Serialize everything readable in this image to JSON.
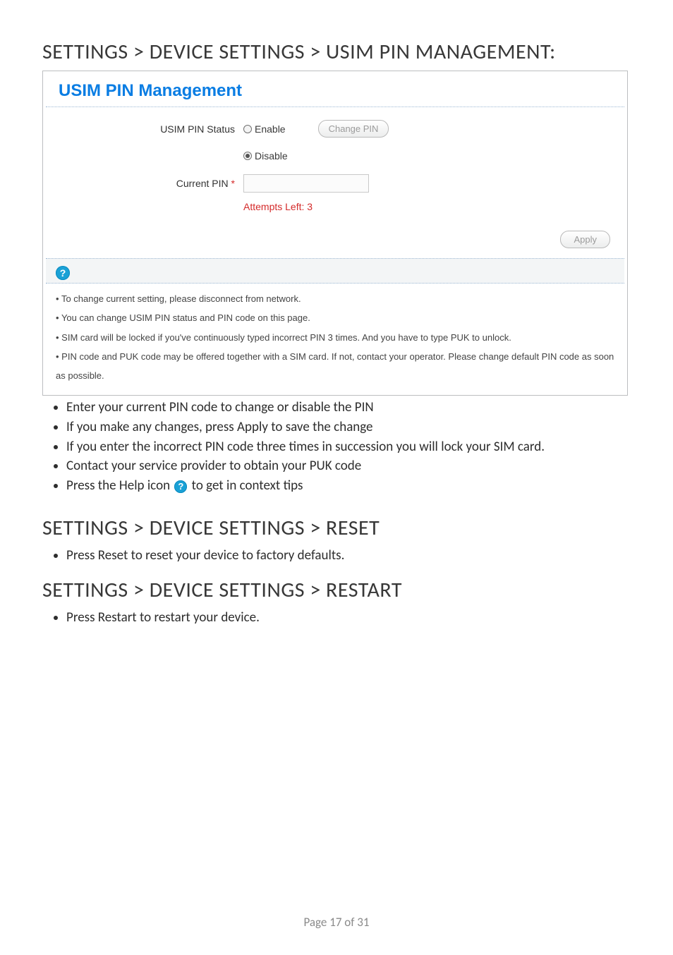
{
  "section1": {
    "heading": "SETTINGS > DEVICE SETTINGS > USIM PIN MANAGEMENT:",
    "panel": {
      "title": "USIM PIN Management",
      "status_label": "USIM PIN Status",
      "enable_label": "Enable",
      "disable_label": "Disable",
      "change_pin_btn": "Change PIN",
      "current_pin_label": "Current PIN",
      "attempts_text": "Attempts Left: 3",
      "apply_btn": "Apply",
      "help_glyph": "?",
      "help_items": [
        "To change current setting, please disconnect from network.",
        "You can change USIM PIN status and PIN code on this page.",
        "SIM card will be locked if you've continuously typed incorrect PIN 3 times. And you have to type PUK to unlock.",
        "PIN code and PUK code may be offered together with a SIM card. If not, contact your operator. Please change default PIN code as soon as possible."
      ]
    },
    "doc_list": {
      "item1": "Enter your current PIN code to change or disable the PIN",
      "item2": "If you make any changes, press Apply to save the change",
      "item3": "If you enter the incorrect PIN code three times in succession you will lock your SIM card.",
      "item4": "Contact your service provider to obtain your PUK code",
      "item5_pre": "Press the Help icon ",
      "item5_post": " to get in context tips"
    }
  },
  "section2": {
    "heading": "SETTINGS > DEVICE SETTINGS > RESET",
    "items": [
      "Press Reset to reset your device to factory defaults."
    ]
  },
  "section3": {
    "heading": "SETTINGS > DEVICE SETTINGS > RESTART",
    "items": [
      "Press Restart to restart your device."
    ]
  },
  "footer": "Page 17 of 31"
}
